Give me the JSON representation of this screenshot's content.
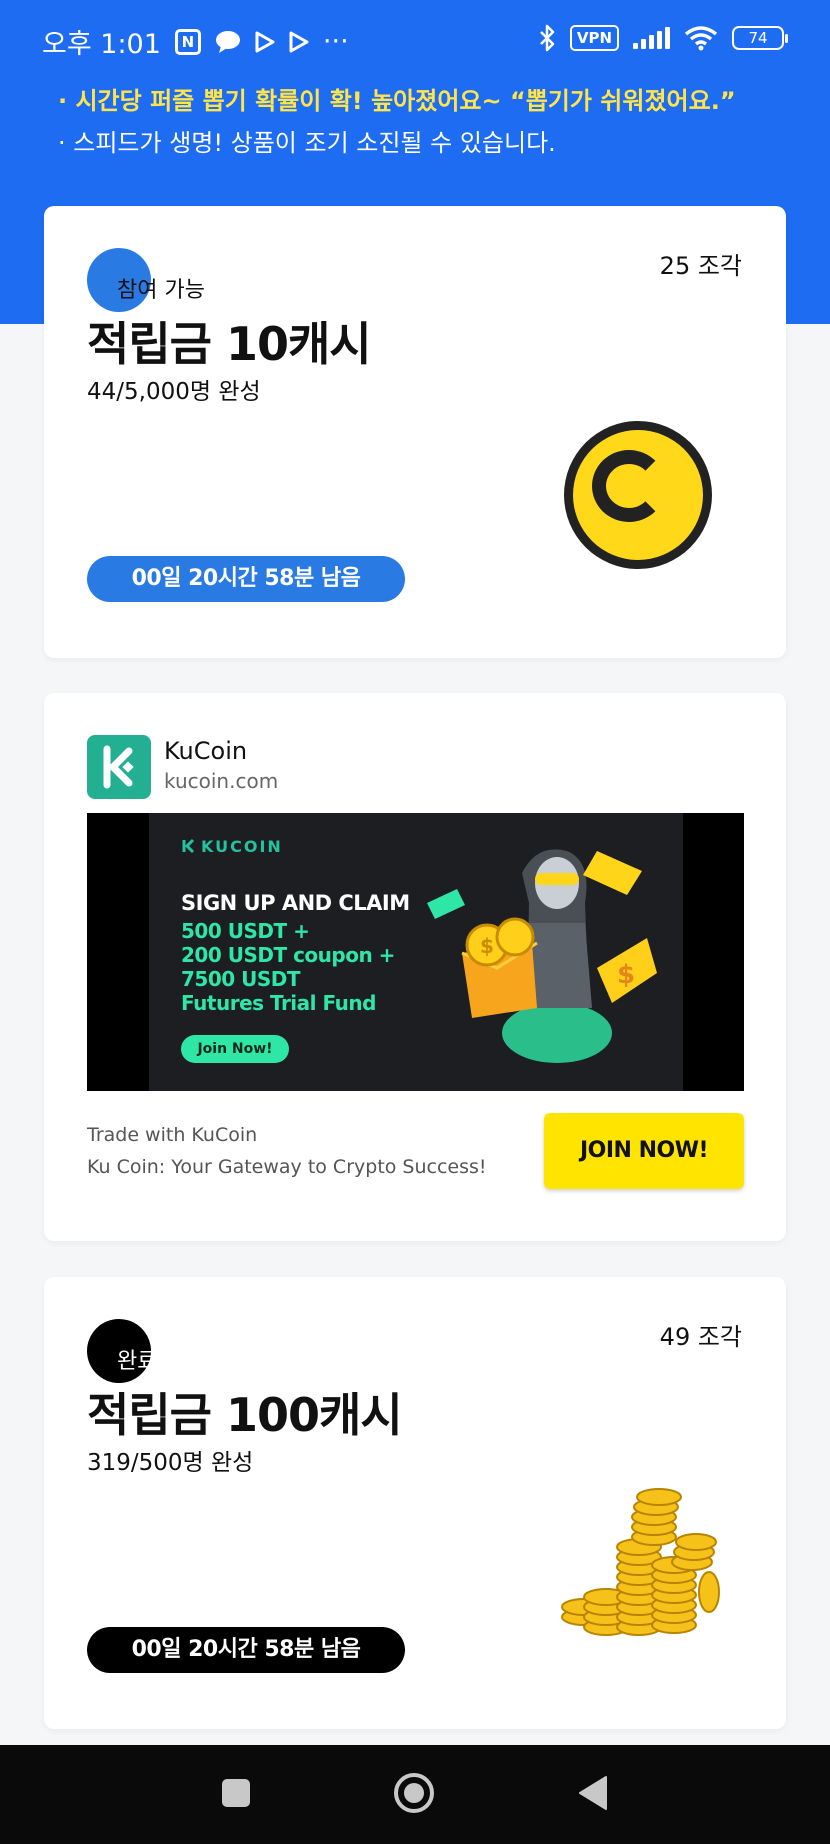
{
  "status_bar": {
    "time": "오후 1:01",
    "more": "···",
    "vpn": "VPN",
    "battery": "74"
  },
  "notice": {
    "line1": "· 시간당 퍼즐 뽑기 확률이 확! 높아졌어요~ “뽑기가 쉬워졌어요.”",
    "line2": "· 스피드가 생명! 상품이 조기 소진될 수 있습니다."
  },
  "prizes": [
    {
      "status": "참여 가능",
      "pieces": "25 조각",
      "title": "적립금 10캐시",
      "completion": "44/5,000명 완성",
      "timer": "00일 20시간 58분 남음",
      "accent": "#2a7ae4"
    },
    {
      "status": "완료",
      "pieces": "49 조각",
      "title": "적립금 100캐시",
      "completion": "319/500명 완성",
      "timer": "00일 20시간 58분 남음",
      "accent": "#000000"
    }
  ],
  "ad": {
    "advertiser": "KuCoin",
    "domain": "kucoin.com",
    "banner": {
      "brand": "KUCOIN",
      "headline": "SIGN UP AND CLAIM",
      "lines": [
        "500 USDT +",
        "200 USDT coupon +",
        "7500 USDT",
        "Futures Trial Fund"
      ],
      "button": "Join Now!"
    },
    "description1": "Trade with KuCoin",
    "description2": "Ku Coin: Your Gateway to Crypto Success!",
    "cta": "JOIN NOW!",
    "brand_color": "#23af91"
  },
  "nav": {
    "icons": [
      "recent-apps-icon",
      "home-icon",
      "back-icon"
    ]
  }
}
